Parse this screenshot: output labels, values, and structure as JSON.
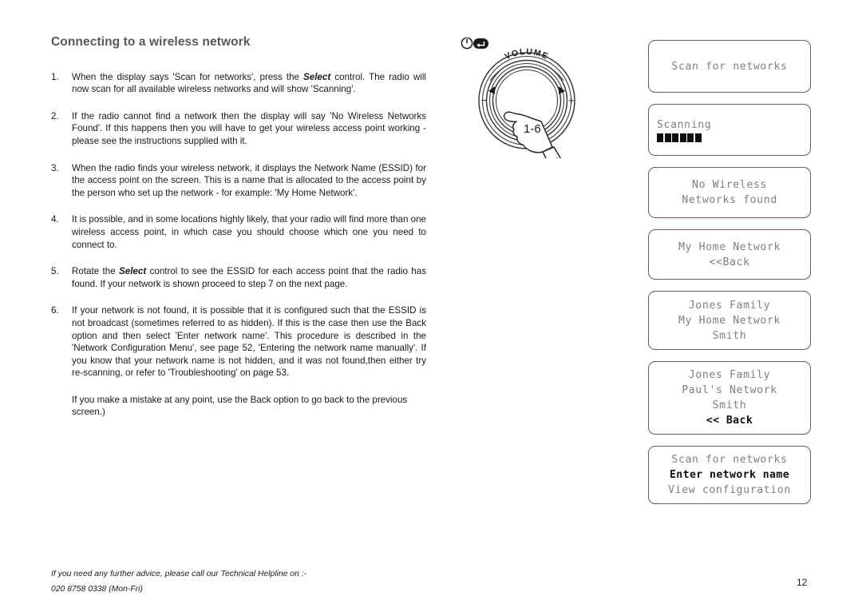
{
  "document": {
    "title": "Connecting to a wireless network",
    "page_number": "12"
  },
  "steps": [
    {
      "number": "1.",
      "parts": [
        {
          "text": "When the display says 'Scan for networks', press the ",
          "style": "normal"
        },
        {
          "text": "Select",
          "style": "bold-italic"
        },
        {
          "text": " control. The radio will now scan for all available wireless networks and will show 'Scanning'.",
          "style": "normal"
        }
      ]
    },
    {
      "number": "2.",
      "parts": [
        {
          "text": "If the radio cannot find a network then the display will say 'No Wireless Networks Found'. If this happens then you will have to get your wireless access point working - please see the instructions supplied with it.",
          "style": "normal"
        }
      ]
    },
    {
      "number": "3.",
      "parts": [
        {
          "text": "When the radio finds your wireless network, it displays the Network Name (ESSID) for the access point on the screen. This is a name that is allocated to the access point by the person who set up the network - for example: 'My Home Network'.",
          "style": "normal"
        }
      ]
    },
    {
      "number": "4.",
      "parts": [
        {
          "text": "It is possible, and in some locations highly likely, that your radio will find more than one wireless access point, in which case you should choose which one you need to connect to.",
          "style": "normal"
        }
      ]
    },
    {
      "number": "5.",
      "parts": [
        {
          "text": "Rotate the ",
          "style": "normal"
        },
        {
          "text": "Select",
          "style": "bold-italic"
        },
        {
          "text": " control to see the ESSID for each access point that the radio has found. If your network is shown proceed to step 7 on the next page.",
          "style": "normal"
        }
      ]
    },
    {
      "number": "6.",
      "parts": [
        {
          "text": "If your network is not found, it is possible that it is configured such that the ESSID is not  broadcast (sometimes referred to as hidden). If this is the case then use the Back option and then select 'Enter network name'. This procedure is described in the 'Network Configuration Menu', see page 52, 'Entering the network name manually'. If you know that your network name is not hidden, and it was not found,then either try re-scanning, or refer to 'Troubleshooting' on page 53.",
          "style": "normal"
        }
      ]
    }
  ],
  "note": "If you make a mistake at any point, use the Back option to go back to the previous screen.)",
  "helpline": {
    "line1": "If you need any further advice, please call our Technical Helpline on :-",
    "line2": "020 8758 0338 (Mon-Fri)"
  },
  "knob": {
    "volume_label": "VOLUME",
    "minus_label": "−",
    "plus_label": "+",
    "step_badge": "1-6",
    "power_icon": "power-icon",
    "back_icon": "back-icon"
  },
  "screens": [
    {
      "name": "scan-for-networks",
      "align": "center",
      "size": "h1",
      "lines": [
        {
          "text": "Scan for networks",
          "bold": false
        }
      ],
      "progress_blocks": 0
    },
    {
      "name": "scanning",
      "align": "left",
      "size": "h2",
      "lines": [
        {
          "text": "Scanning",
          "bold": false
        }
      ],
      "progress_blocks": 6
    },
    {
      "name": "no-wireless-networks-found",
      "align": "center",
      "size": "h3",
      "lines": [
        {
          "text": "No Wireless",
          "bold": false
        },
        {
          "text": "Networks found",
          "bold": false
        }
      ],
      "progress_blocks": 0
    },
    {
      "name": "my-home-network",
      "align": "center",
      "size": "h4",
      "lines": [
        {
          "text": "My Home Network",
          "bold": false
        },
        {
          "text": "<<Back",
          "bold": false
        }
      ],
      "progress_blocks": 0
    },
    {
      "name": "network-list",
      "align": "center",
      "size": "h5",
      "lines": [
        {
          "text": "Jones Family",
          "bold": false
        },
        {
          "text": "My Home Network",
          "bold": false
        },
        {
          "text": "Smith",
          "bold": false
        }
      ],
      "progress_blocks": 0
    },
    {
      "name": "network-list-with-back",
      "align": "center",
      "size": "h6",
      "lines": [
        {
          "text": "Jones Family",
          "bold": false
        },
        {
          "text": "Paul's Network",
          "bold": false
        },
        {
          "text": "Smith",
          "bold": false
        },
        {
          "text": "<< Back",
          "bold": true
        }
      ],
      "progress_blocks": 0
    },
    {
      "name": "network-configuration-menu",
      "align": "center",
      "size": "h7",
      "lines": [
        {
          "text": "Scan for networks",
          "bold": false
        },
        {
          "text": "Enter network name",
          "bold": true
        },
        {
          "text": "View configuration",
          "bold": false
        }
      ],
      "progress_blocks": 0
    }
  ]
}
